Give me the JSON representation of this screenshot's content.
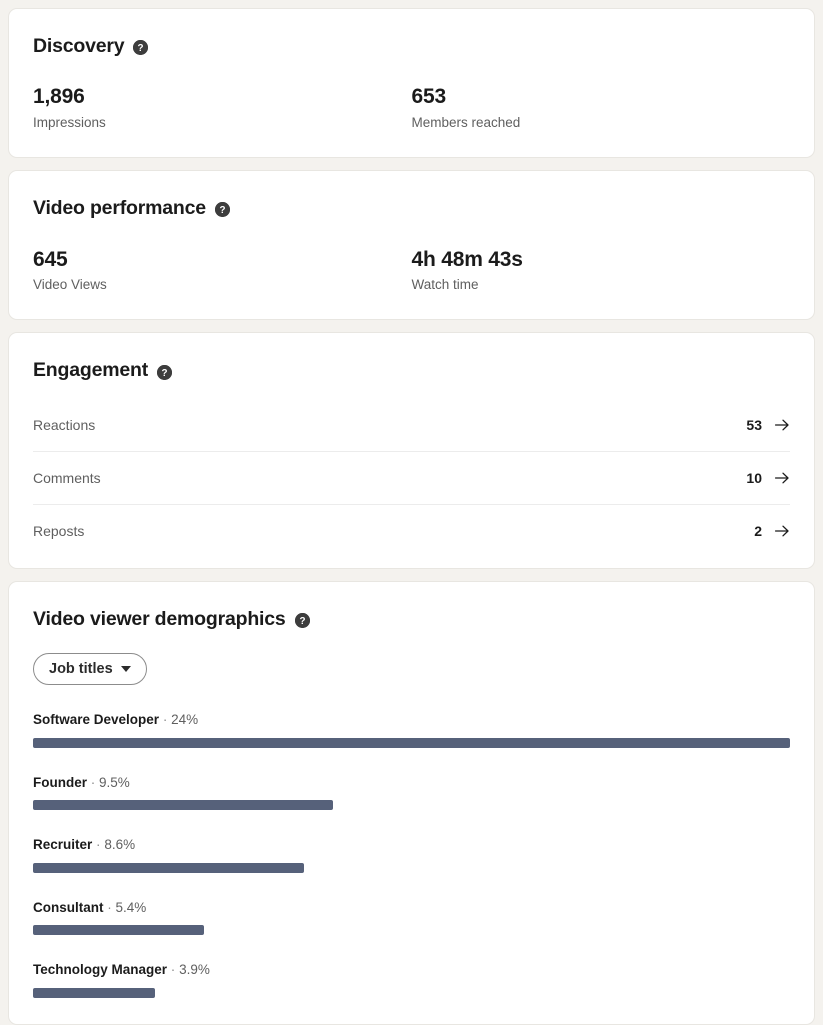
{
  "discovery": {
    "title": "Discovery",
    "help_icon": "help-circle-icon",
    "stats": [
      {
        "value": "1,896",
        "label": "Impressions"
      },
      {
        "value": "653",
        "label": "Members reached"
      }
    ]
  },
  "video_performance": {
    "title": "Video performance",
    "help_icon": "help-circle-icon",
    "stats": [
      {
        "value": "645",
        "label": "Video Views"
      },
      {
        "value": "4h 48m 43s",
        "label": "Watch time"
      }
    ]
  },
  "engagement": {
    "title": "Engagement",
    "help_icon": "help-circle-icon",
    "rows": [
      {
        "label": "Reactions",
        "value": "53",
        "arrow_icon": "arrow-right-icon"
      },
      {
        "label": "Comments",
        "value": "10",
        "arrow_icon": "arrow-right-icon"
      },
      {
        "label": "Reposts",
        "value": "2",
        "arrow_icon": "arrow-right-icon"
      }
    ]
  },
  "demographics": {
    "title": "Video viewer demographics",
    "help_icon": "help-circle-icon",
    "filter": {
      "label": "Job titles",
      "caret_icon": "chevron-down-icon"
    },
    "separator": "·",
    "bar_color": "#56617a",
    "chart_data": {
      "type": "bar",
      "title": "Video viewer demographics",
      "xlabel": "",
      "ylabel": "",
      "categories": [
        "Software Developer",
        "Founder",
        "Recruiter",
        "Consultant",
        "Technology Manager"
      ],
      "values": [
        24,
        9.5,
        8.6,
        5.4,
        3.9
      ],
      "value_labels": [
        "24%",
        "9.5%",
        "8.6%",
        "5.4%",
        "3.9%"
      ],
      "bar_fill_pct": [
        100,
        39.6,
        35.8,
        22.6,
        16.1
      ],
      "xlim": [
        0,
        24
      ],
      "grid": false,
      "legend": false,
      "orientation": "horizontal"
    }
  }
}
